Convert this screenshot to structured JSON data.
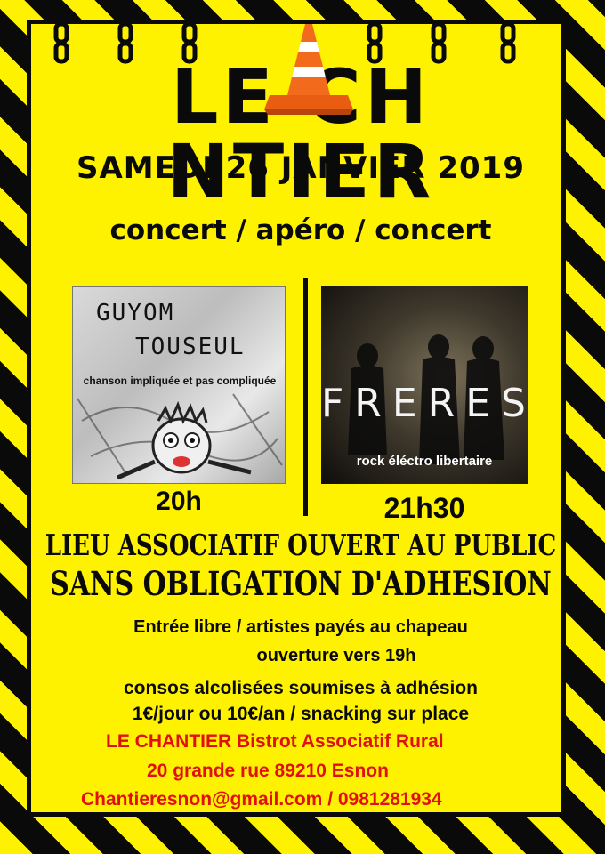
{
  "poster": {
    "logo": "LE CH NTIER",
    "date": "SAMEDI 26 JANVIER 2019",
    "subtitle": "concert / apéro / concert"
  },
  "artist1": {
    "name_line1": "GUYOM",
    "name_line2": "TOUSEUL",
    "tagline": "chanson impliquée et pas compliquée",
    "time": "20h"
  },
  "artist2": {
    "name": "FRERES",
    "genre": "rock éléctro libertaire",
    "time": "21h30"
  },
  "venue": {
    "line1": "LIEU ASSOCIATIF OUVERT AU PUBLIC",
    "line2": "SANS OBLIGATION D'ADHESION"
  },
  "info": {
    "entry": "Entrée libre / artistes payés au chapeau",
    "opening": "ouverture vers 19h",
    "drinks": "consos alcolisées soumises à adhésion",
    "prices": "1€/jour ou 10€/an / snacking sur place"
  },
  "contact": {
    "name": "LE CHANTIER Bistrot Associatif Rural",
    "address": "20 grande rue 89210 Esnon",
    "email_phone": "Chantieresnon@gmail.com / 0981281934"
  },
  "colors": {
    "yellow": "#fff200",
    "black": "#0a0a0a",
    "red": "#e01010",
    "cone_orange": "#f26a1b"
  }
}
